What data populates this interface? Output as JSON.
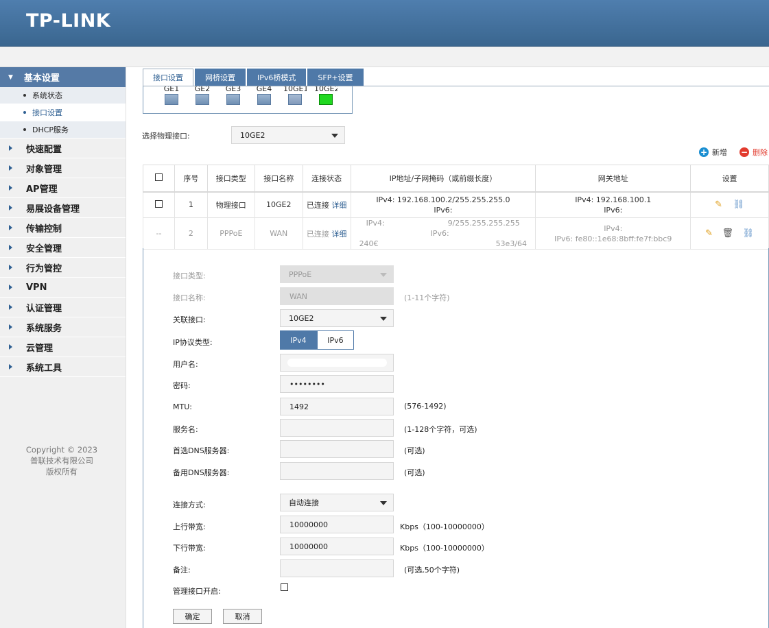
{
  "brand": {
    "logo_text": "TP-LINK"
  },
  "sidebar": {
    "group_title": "基本设置",
    "sub_items": [
      {
        "label": "系统状态"
      },
      {
        "label": "接口设置"
      },
      {
        "label": "DHCP服务"
      }
    ],
    "items": [
      {
        "label": "快速配置"
      },
      {
        "label": "对象管理"
      },
      {
        "label": "AP管理"
      },
      {
        "label": "易展设备管理"
      },
      {
        "label": "传输控制"
      },
      {
        "label": "安全管理"
      },
      {
        "label": "行为管控"
      },
      {
        "label": "VPN"
      },
      {
        "label": "认证管理"
      },
      {
        "label": "系统服务"
      },
      {
        "label": "云管理"
      },
      {
        "label": "系统工具"
      }
    ],
    "copyright": {
      "line1": "Copyright © 2023",
      "line2": "普联技术有限公司",
      "line3": "版权所有"
    }
  },
  "tabs": [
    {
      "label": "接口设置"
    },
    {
      "label": "网桥设置"
    },
    {
      "label": "IPv6桥模式"
    },
    {
      "label": "SFP+设置"
    }
  ],
  "ports": [
    {
      "label": "GE1",
      "status": "down"
    },
    {
      "label": "GE2",
      "status": "down"
    },
    {
      "label": "GE3",
      "status": "down"
    },
    {
      "label": "GE4",
      "status": "down"
    },
    {
      "label": "10GE1",
      "status": "down"
    },
    {
      "label": "10GE2",
      "status": "up"
    }
  ],
  "physical": {
    "label": "选择物理接口:",
    "value": "10GE2"
  },
  "actions": {
    "add": "新增",
    "delete": "删除",
    "add_color": "#1a8ed1",
    "delete_color": "#e23b2e"
  },
  "table": {
    "headers": [
      "序号",
      "接口类型",
      "接口名称",
      "连接状态",
      "IP地址/子网掩码（或前缀长度）",
      "网关地址",
      "设置"
    ],
    "rows": [
      {
        "index": "1",
        "type": "物理接口",
        "name": "10GE2",
        "status": "已连接",
        "detail": "详细",
        "ip_v4": "IPv4:   192.168.100.2/255.255.255.0",
        "ip_v6": "IPv6:",
        "gw_v4": "IPv4:   192.168.100.1",
        "gw_v6": "IPv6:"
      },
      {
        "index": "2",
        "select": "--",
        "type": "PPPoE",
        "name": "WAN",
        "status": "已连接",
        "detail": "详细",
        "ip_v4_a": "IPv4:",
        "ip_v4_b": "9/255.255.255.255",
        "ip_v6_a": "IPv6:",
        "ip_v6_b": "240€",
        "ip_v6_c": "53e3/64",
        "gw_v4": "IPv4:",
        "gw_v6": "IPv6:   fe80::1e68:8bff:fe7f:bbc9"
      }
    ]
  },
  "form": {
    "type": {
      "label": "接口类型:",
      "value": "PPPoE"
    },
    "name": {
      "label": "接口名称:",
      "value": "WAN",
      "hint": "(1-11个字符)"
    },
    "bind": {
      "label": "关联接口:",
      "value": "10GE2"
    },
    "protocol": {
      "label": "IP协议类型:",
      "v4": "IPv4",
      "v6": "IPv6",
      "selected": "IPv4"
    },
    "username": {
      "label": "用户名:"
    },
    "password": {
      "label": "密码:",
      "value": "••••••••"
    },
    "mtu": {
      "label": "MTU:",
      "value": "1492",
      "hint": "(576-1492)"
    },
    "service": {
      "label": "服务名:",
      "hint": "(1-128个字符，可选)"
    },
    "dns1": {
      "label": "首选DNS服务器:",
      "hint": "(可选)"
    },
    "dns2": {
      "label": "备用DNS服务器:",
      "hint": "(可选)"
    },
    "mode": {
      "label": "连接方式:",
      "value": "自动连接"
    },
    "up": {
      "label": "上行带宽:",
      "value": "10000000",
      "hint": "Kbps（100-10000000）"
    },
    "down": {
      "label": "下行带宽:",
      "value": "10000000",
      "hint": "Kbps（100-10000000）"
    },
    "note": {
      "label": "备注:",
      "hint": "(可选,50个字符)"
    },
    "mgmt": {
      "label": "管理接口开启:"
    },
    "ok": "确定",
    "cancel": "取消"
  }
}
